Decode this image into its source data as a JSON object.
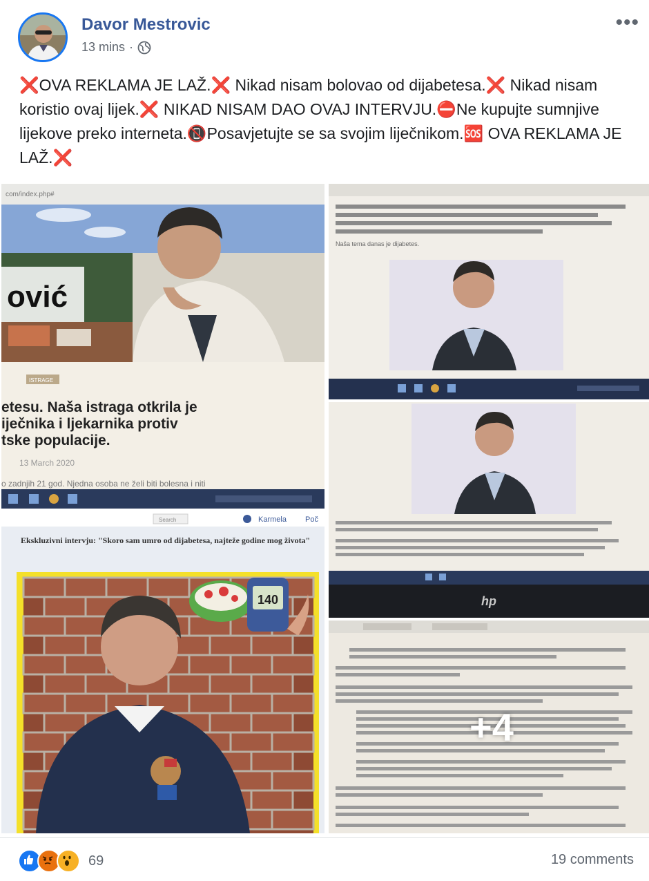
{
  "post": {
    "author": "Davor Mestrovic",
    "time": "13 mins",
    "separator": "·",
    "more": "•••",
    "text_segments": [
      {
        "type": "x",
        "text": "❌"
      },
      {
        "type": "t",
        "text": "OVA REKLAMA JE LAŽ."
      },
      {
        "type": "x",
        "text": "❌"
      },
      {
        "type": "t",
        "text": " Nikad nisam bolovao od dijabetesa."
      },
      {
        "type": "x",
        "text": "❌"
      },
      {
        "type": "t",
        "text": " Nikad nisam koristio ovaj lijek."
      },
      {
        "type": "x",
        "text": "❌"
      },
      {
        "type": "t",
        "text": " NIKAD NISAM DAO OVAJ INTERVJU."
      },
      {
        "type": "x",
        "text": "⛔"
      },
      {
        "type": "t",
        "text": "Ne kupujte sumnjive lijekove preko interneta."
      },
      {
        "type": "x",
        "text": "📵"
      },
      {
        "type": "t",
        "text": "Posavjetujte se sa svojim liječnikom."
      },
      {
        "type": "x",
        "text": "🆘"
      },
      {
        "type": "t",
        "text": " OVA REKLAMA JE LAŽ."
      },
      {
        "type": "x",
        "text": "❌"
      }
    ]
  },
  "photos": {
    "p1": {
      "url": "com/index.php#",
      "brand": "ović",
      "tag": "ISTRAGE",
      "headline": [
        "etesu. Naša istraga otkrila je",
        "iječnika i ljekarnika protiv",
        "tske populacije."
      ],
      "date": "13 March 2020",
      "snippet": "o zadnjih 21 god. Njedna osoba ne želi biti bolesna i niti"
    },
    "p2": {
      "para": "Shvatili u potrazi za medicine postali su gotovo svakog u mome. Njihova osoba ne želi biti bolesna i nije spremna umrijeti rano. Mala temperatura i lijekovi nisu uspjeli.",
      "line": "Naša tema danas je dijabetes."
    },
    "p3": {
      "para": "Bolest u mom zivotu, a mnogi od ovih pacijenata su bolovali i nisu dobili pravu pomoć na vrijeme. Moje je iskustvo da svaka bolest traži pravi lijek.",
      "logo": "hp"
    },
    "p4": {
      "search": "Search",
      "user": "Karmela",
      "nav": "Poč",
      "title": "Ekskluzivni intervju: \"Skoro sam umro od dijabetesa, najteže godine mog života\"",
      "meter": "140"
    },
    "p5": {
      "para": "Ne, da dijabetes prouzrokuje mnogo problema u organizmu ja sam znao i ranije, dok nisam sam se i obratio lekaru.",
      "plus": "+4"
    }
  },
  "footer": {
    "reaction_count": "69",
    "comments": "19 comments"
  },
  "colors": {
    "name_blue": "#385898",
    "like_blue": "#1877f2",
    "angry": "#e9710f",
    "wow": "#f7b125",
    "muted": "#606770"
  }
}
